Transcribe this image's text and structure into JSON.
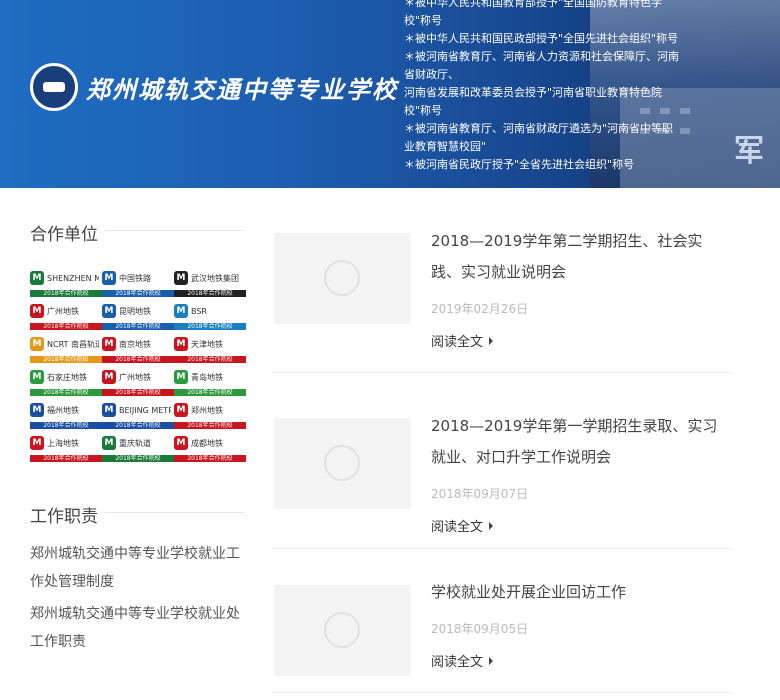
{
  "banner": {
    "school_name": "郑州城轨交通中等专业学校",
    "honors": [
      "＊被中华人民共和国教育部授予\"全国国防教育特色学校\"称号",
      "＊被中华人民共和国民政部授予\"全国先进社会组织\"称号",
      "＊被河南省教育厅、河南省人力资源和社会保障厅、河南省财政厅、",
      "河南省发展和改革委员会授予\"河南省职业教育特色院校\"称号",
      "＊被河南省教育厅、河南省财政厅遴选为\"河南省中等职业教育智慧校园\"",
      "＊被河南省民政厅授予\"全省先进社会组织\"称号"
    ],
    "corner_char": "军"
  },
  "sidebar": {
    "partners_title": "合作单位",
    "partners": [
      {
        "name": "SHENZHEN METRO",
        "icon": "metro-icon",
        "color": "#1a7a3a",
        "bar": "2018年合作院校"
      },
      {
        "name": "中国铁路",
        "icon": "rail-icon",
        "color": "#1a5fae",
        "bar": "2018年合作院校"
      },
      {
        "name": "武汉地铁集团",
        "icon": "metro-icon",
        "color": "#222222",
        "bar": "2018年合作院校"
      },
      {
        "name": "广州地铁",
        "icon": "metro-icon",
        "color": "#c8161e",
        "bar": "2018年合作院校"
      },
      {
        "name": "昆明地铁",
        "icon": "metro-icon",
        "color": "#1a5fae",
        "bar": "2018年合作院校"
      },
      {
        "name": "BSR",
        "icon": "rail-icon",
        "color": "#1a7fbf",
        "bar": "2018年合作院校"
      },
      {
        "name": "NCRT 南昌轨道",
        "icon": "metro-icon",
        "color": "#e39a1a",
        "bar": "2018年合作院校"
      },
      {
        "name": "南京地铁",
        "icon": "metro-icon",
        "color": "#c8161e",
        "bar": "2018年合作院校"
      },
      {
        "name": "天津地铁",
        "icon": "metro-icon",
        "color": "#c8161e",
        "bar": "2018年合作院校"
      },
      {
        "name": "石家庄地铁",
        "icon": "metro-icon",
        "color": "#2c9a3c",
        "bar": "2018年合作院校"
      },
      {
        "name": "广州地铁",
        "icon": "metro-icon",
        "color": "#c8161e",
        "bar": "2018年合作院校"
      },
      {
        "name": "青岛地铁",
        "icon": "metro-icon",
        "color": "#2c9a3c",
        "bar": "2018年合作院校"
      },
      {
        "name": "福州地铁",
        "icon": "metro-icon",
        "color": "#1a4ea0",
        "bar": "2018年合作院校"
      },
      {
        "name": "BEIJING METRO",
        "icon": "metro-icon",
        "color": "#1a4ea0",
        "bar": "2018年合作院校"
      },
      {
        "name": "郑州地铁",
        "icon": "metro-icon",
        "color": "#c8161e",
        "bar": "2018年合作院校"
      },
      {
        "name": "上海地铁",
        "icon": "metro-icon",
        "color": "#c8161e",
        "bar": "2018年合作院校"
      },
      {
        "name": "重庆轨道",
        "icon": "rail-icon",
        "color": "#1a7a3a",
        "bar": "2018年合作院校"
      },
      {
        "name": "成都地铁",
        "icon": "metro-icon",
        "color": "#c8161e",
        "bar": "2018年合作院校"
      }
    ],
    "duty_title": "工作职责",
    "duty_links": [
      "郑州城轨交通中等专业学校就业工作处管理制度",
      "郑州城轨交通中等专业学校就业处工作职责"
    ]
  },
  "news": [
    {
      "title": "2018—2019学年第二学期招生、社会实践、实习就业说明会",
      "date": "2019年02月26日",
      "read_more": "阅读全文"
    },
    {
      "title": "2018—2019学年第一学期招生录取、实习就业、对口升学工作说明会",
      "date": "2018年09月07日",
      "read_more": "阅读全文"
    },
    {
      "title": "学校就业处开展企业回访工作",
      "date": "2018年09月05日",
      "read_more": "阅读全文"
    }
  ]
}
